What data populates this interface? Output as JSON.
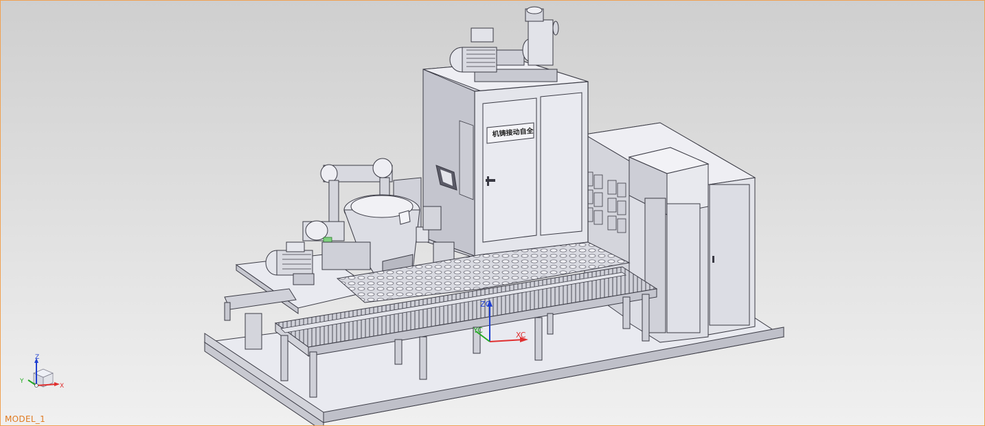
{
  "viewport": {
    "model_name": "MODEL_1",
    "accent_color": "#f0a050"
  },
  "model": {
    "cabinet_sign": "机铸接动自全"
  },
  "wcs": {
    "xc_label": "XC",
    "yc_label": "YC",
    "zc_label": "ZC"
  },
  "triad": {
    "x_label": "X",
    "y_label": "Y",
    "z_label": "Z"
  },
  "colors": {
    "metal_light": "#e8e9ef",
    "metal_mid": "#c9cad3",
    "metal_dark": "#a9aab3",
    "edge": "#3a3a44",
    "axis_x": "#e03030",
    "axis_y": "#22aa22",
    "axis_z": "#2040d0"
  }
}
